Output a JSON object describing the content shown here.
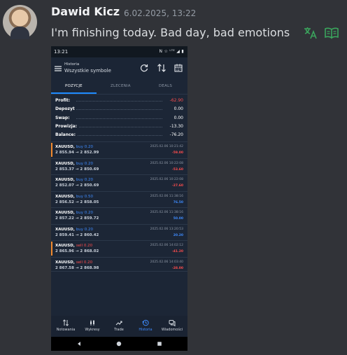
{
  "message": {
    "author": "Dawid Kicz",
    "timestamp": "6.02.2025, 13:22",
    "text": "I'm finishing today. Bad day, bad emotions",
    "actions": [
      "translate-icon",
      "read-icon"
    ]
  },
  "phone": {
    "status_time": "13:21",
    "status_indicators": "N ☆ ᴸᵀᴱ ◢ ▮",
    "header": {
      "section": "Historia",
      "title": "Wszystkie symbole"
    },
    "tabs": [
      {
        "label": "POZYCJE",
        "active": true
      },
      {
        "label": "ZLECENIA",
        "active": false
      },
      {
        "label": "DEALS",
        "active": false
      }
    ],
    "summary": [
      {
        "label": "Profit:",
        "value": "-62.90",
        "negative": true
      },
      {
        "label": "Depozyt",
        "value": "0.00",
        "negative": false
      },
      {
        "label": "Swap:",
        "value": "0.00",
        "negative": false
      },
      {
        "label": "Prowizja:",
        "value": "-13.30",
        "negative": false
      },
      {
        "label": "Balance:",
        "value": "-76.20",
        "negative": false
      }
    ],
    "deals": [
      {
        "symbol": "XAUUSD,",
        "side": "buy 0.20",
        "side_type": "buy",
        "prices": "2 855.94 → 2 852.99",
        "datetime": "2025.02.06 10:21:42",
        "pl": "-59.00",
        "pl_negative": true,
        "flag": true
      },
      {
        "symbol": "XAUUSD,",
        "side": "buy 0.20",
        "side_type": "buy",
        "prices": "2 853.37 → 2 850.69",
        "datetime": "2025.02.06 10:22:08",
        "pl": "-53.60",
        "pl_negative": true,
        "flag": false
      },
      {
        "symbol": "XAUUSD,",
        "side": "buy 0.20",
        "side_type": "buy",
        "prices": "2 852.07 → 2 850.69",
        "datetime": "2025.02.06 10:22:08",
        "pl": "-27.60",
        "pl_negative": true,
        "flag": false
      },
      {
        "symbol": "XAUUSD,",
        "side": "buy 0.50",
        "side_type": "buy",
        "prices": "2 856.52 → 2 858.05",
        "datetime": "2025.02.06 11:38:16",
        "pl": "76.50",
        "pl_negative": false,
        "flag": false
      },
      {
        "symbol": "XAUUSD,",
        "side": "buy 0.20",
        "side_type": "buy",
        "prices": "2 857.22 → 2 859.72",
        "datetime": "2025.02.06 11:38:16",
        "pl": "50.00",
        "pl_negative": false,
        "flag": false
      },
      {
        "symbol": "XAUUSD,",
        "side": "buy 0.20",
        "side_type": "buy",
        "prices": "2 859.41 → 2 860.42",
        "datetime": "2025.02.06 13:20:53",
        "pl": "20.20",
        "pl_negative": false,
        "flag": false
      },
      {
        "symbol": "XAUUSD,",
        "side": "sell 0.20",
        "side_type": "sell",
        "prices": "2 865.96 → 2 868.02",
        "datetime": "2025.02.06 14:02:12",
        "pl": "-41.20",
        "pl_negative": true,
        "flag": true
      },
      {
        "symbol": "XAUUSD,",
        "side": "sell 0.20",
        "side_type": "sell",
        "prices": "2 867.58 → 2 868.98",
        "datetime": "2025.02.06 14:03:40",
        "pl": "-28.00",
        "pl_negative": true,
        "flag": false
      }
    ],
    "bottom_nav": [
      {
        "label": "Notowania",
        "icon": "quotes-icon",
        "active": false
      },
      {
        "label": "Wykresy",
        "icon": "charts-icon",
        "active": false
      },
      {
        "label": "Trade",
        "icon": "trade-icon",
        "active": false
      },
      {
        "label": "Historia",
        "icon": "history-icon",
        "active": true
      },
      {
        "label": "Wiadomości",
        "icon": "messages-icon",
        "active": false
      }
    ],
    "colors": {
      "accent": "#1e8bff",
      "negative": "#ff4d4d",
      "flag": "#f28a2e",
      "background": "#1c2636"
    }
  }
}
